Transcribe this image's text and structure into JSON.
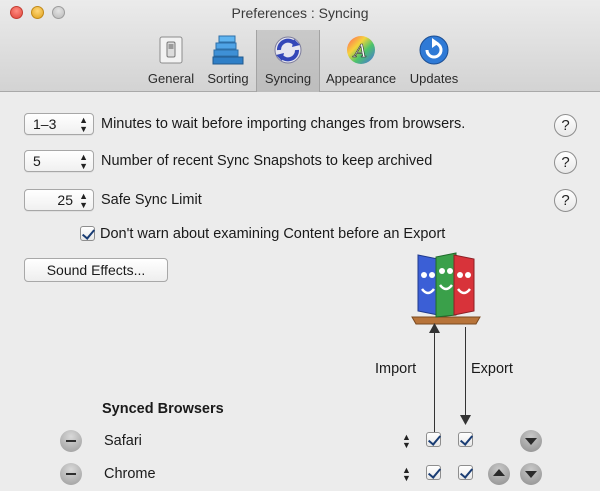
{
  "window": {
    "title": "Preferences : Syncing"
  },
  "toolbar": {
    "items": [
      {
        "label": "General",
        "icon": "general-switch-icon"
      },
      {
        "label": "Sorting",
        "icon": "sorting-stack-icon"
      },
      {
        "label": "Syncing",
        "icon": "syncing-arrows-icon",
        "selected": true
      },
      {
        "label": "Appearance",
        "icon": "color-wheel-icon"
      },
      {
        "label": "Updates",
        "icon": "updates-icon"
      }
    ]
  },
  "settings": {
    "wait": {
      "value": "1–3",
      "label": "Minutes to wait before importing changes from browsers."
    },
    "snapshots": {
      "value": "5",
      "label": "Number of recent Sync Snapshots to keep archived"
    },
    "limit": {
      "value": "25",
      "label": "Safe Sync Limit"
    },
    "dont_warn": {
      "checked": true,
      "label": "Don't warn about examining Content before an Export"
    },
    "sound_button": "Sound Effects...",
    "help_symbol": "?"
  },
  "sync": {
    "import_label": "Import",
    "export_label": "Export",
    "section_title": "Synced Browsers",
    "browsers": [
      {
        "name": "Safari",
        "import": true,
        "export": true
      },
      {
        "name": "Chrome",
        "import": true,
        "export": true
      }
    ]
  },
  "colors": {
    "accent": "#2a7fd9",
    "mask_blue": "#3b5fd6",
    "mask_green": "#3aa04a",
    "mask_red": "#d8333a"
  }
}
